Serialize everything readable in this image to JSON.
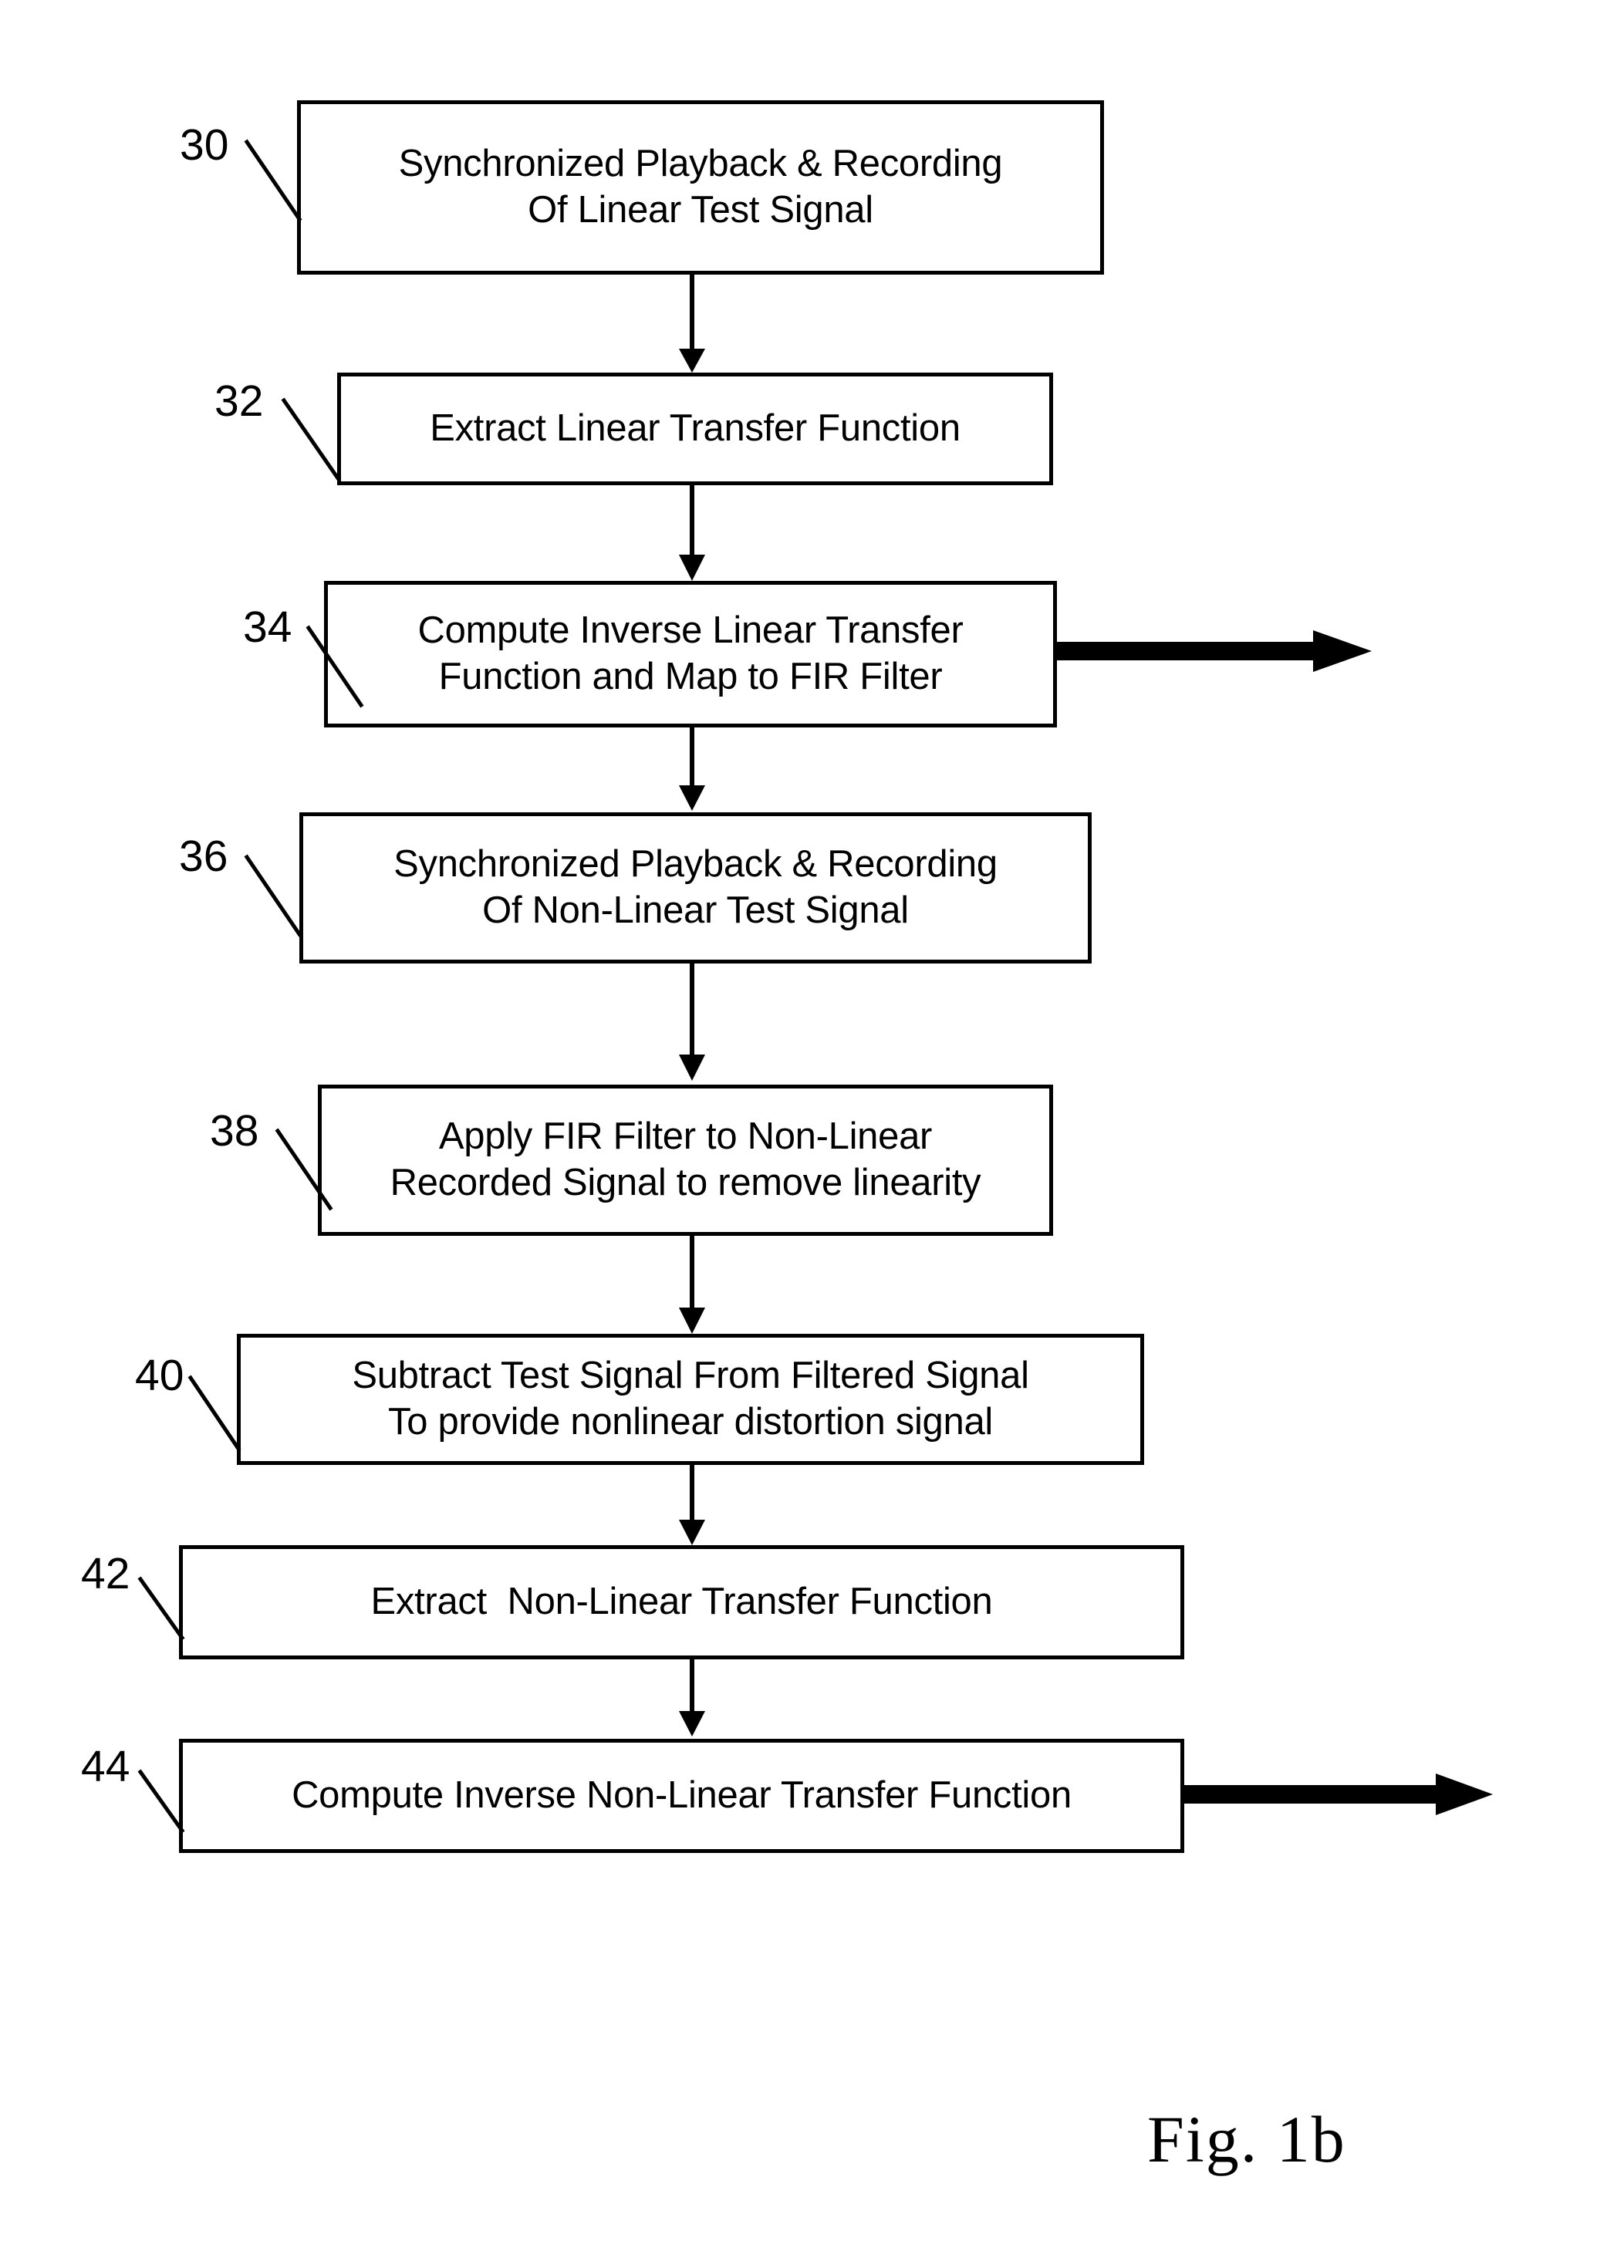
{
  "figure": {
    "caption": "Fig. 1b",
    "type": "patent-flowchart",
    "orientation": "vertical"
  },
  "nodes": [
    {
      "ref": "30",
      "lines": [
        "Synchronized Playback & Recording",
        "Of Linear Test Signal"
      ],
      "line1": "Synchronized Playback & Recording",
      "line2": "Of Linear Test Signal"
    },
    {
      "ref": "32",
      "lines": [
        "Extract Linear Transfer Function"
      ],
      "line1": "Extract Linear Transfer Function",
      "line2": ""
    },
    {
      "ref": "34",
      "lines": [
        "Compute Inverse Linear Transfer",
        "Function and Map to FIR Filter"
      ],
      "line1": "Compute Inverse Linear Transfer",
      "line2": "Function and Map to FIR Filter"
    },
    {
      "ref": "36",
      "lines": [
        "Synchronized Playback & Recording",
        "Of Non-Linear Test Signal"
      ],
      "line1": "Synchronized Playback & Recording",
      "line2": "Of Non-Linear Test Signal"
    },
    {
      "ref": "38",
      "lines": [
        "Apply FIR Filter to Non-Linear",
        "Recorded Signal to remove linearity"
      ],
      "line1": "Apply FIR Filter to Non-Linear",
      "line2": "Recorded Signal to remove linearity"
    },
    {
      "ref": "40",
      "lines": [
        "Subtract Test Signal From Filtered Signal",
        "To provide nonlinear distortion signal"
      ],
      "line1": "Subtract Test Signal From Filtered Signal",
      "line2": "To provide nonlinear distortion signal"
    },
    {
      "ref": "42",
      "lines": [
        "Extract  Non-Linear Transfer Function"
      ],
      "line1": "Extract  Non-Linear Transfer Function",
      "line2": ""
    },
    {
      "ref": "44",
      "lines": [
        "Compute Inverse Non-Linear Transfer Function"
      ],
      "line1": "Compute Inverse Non-Linear Transfer Function",
      "line2": ""
    }
  ],
  "colors": {
    "stroke": "#000000",
    "fill": "#ffffff",
    "background": "#ffffff"
  }
}
